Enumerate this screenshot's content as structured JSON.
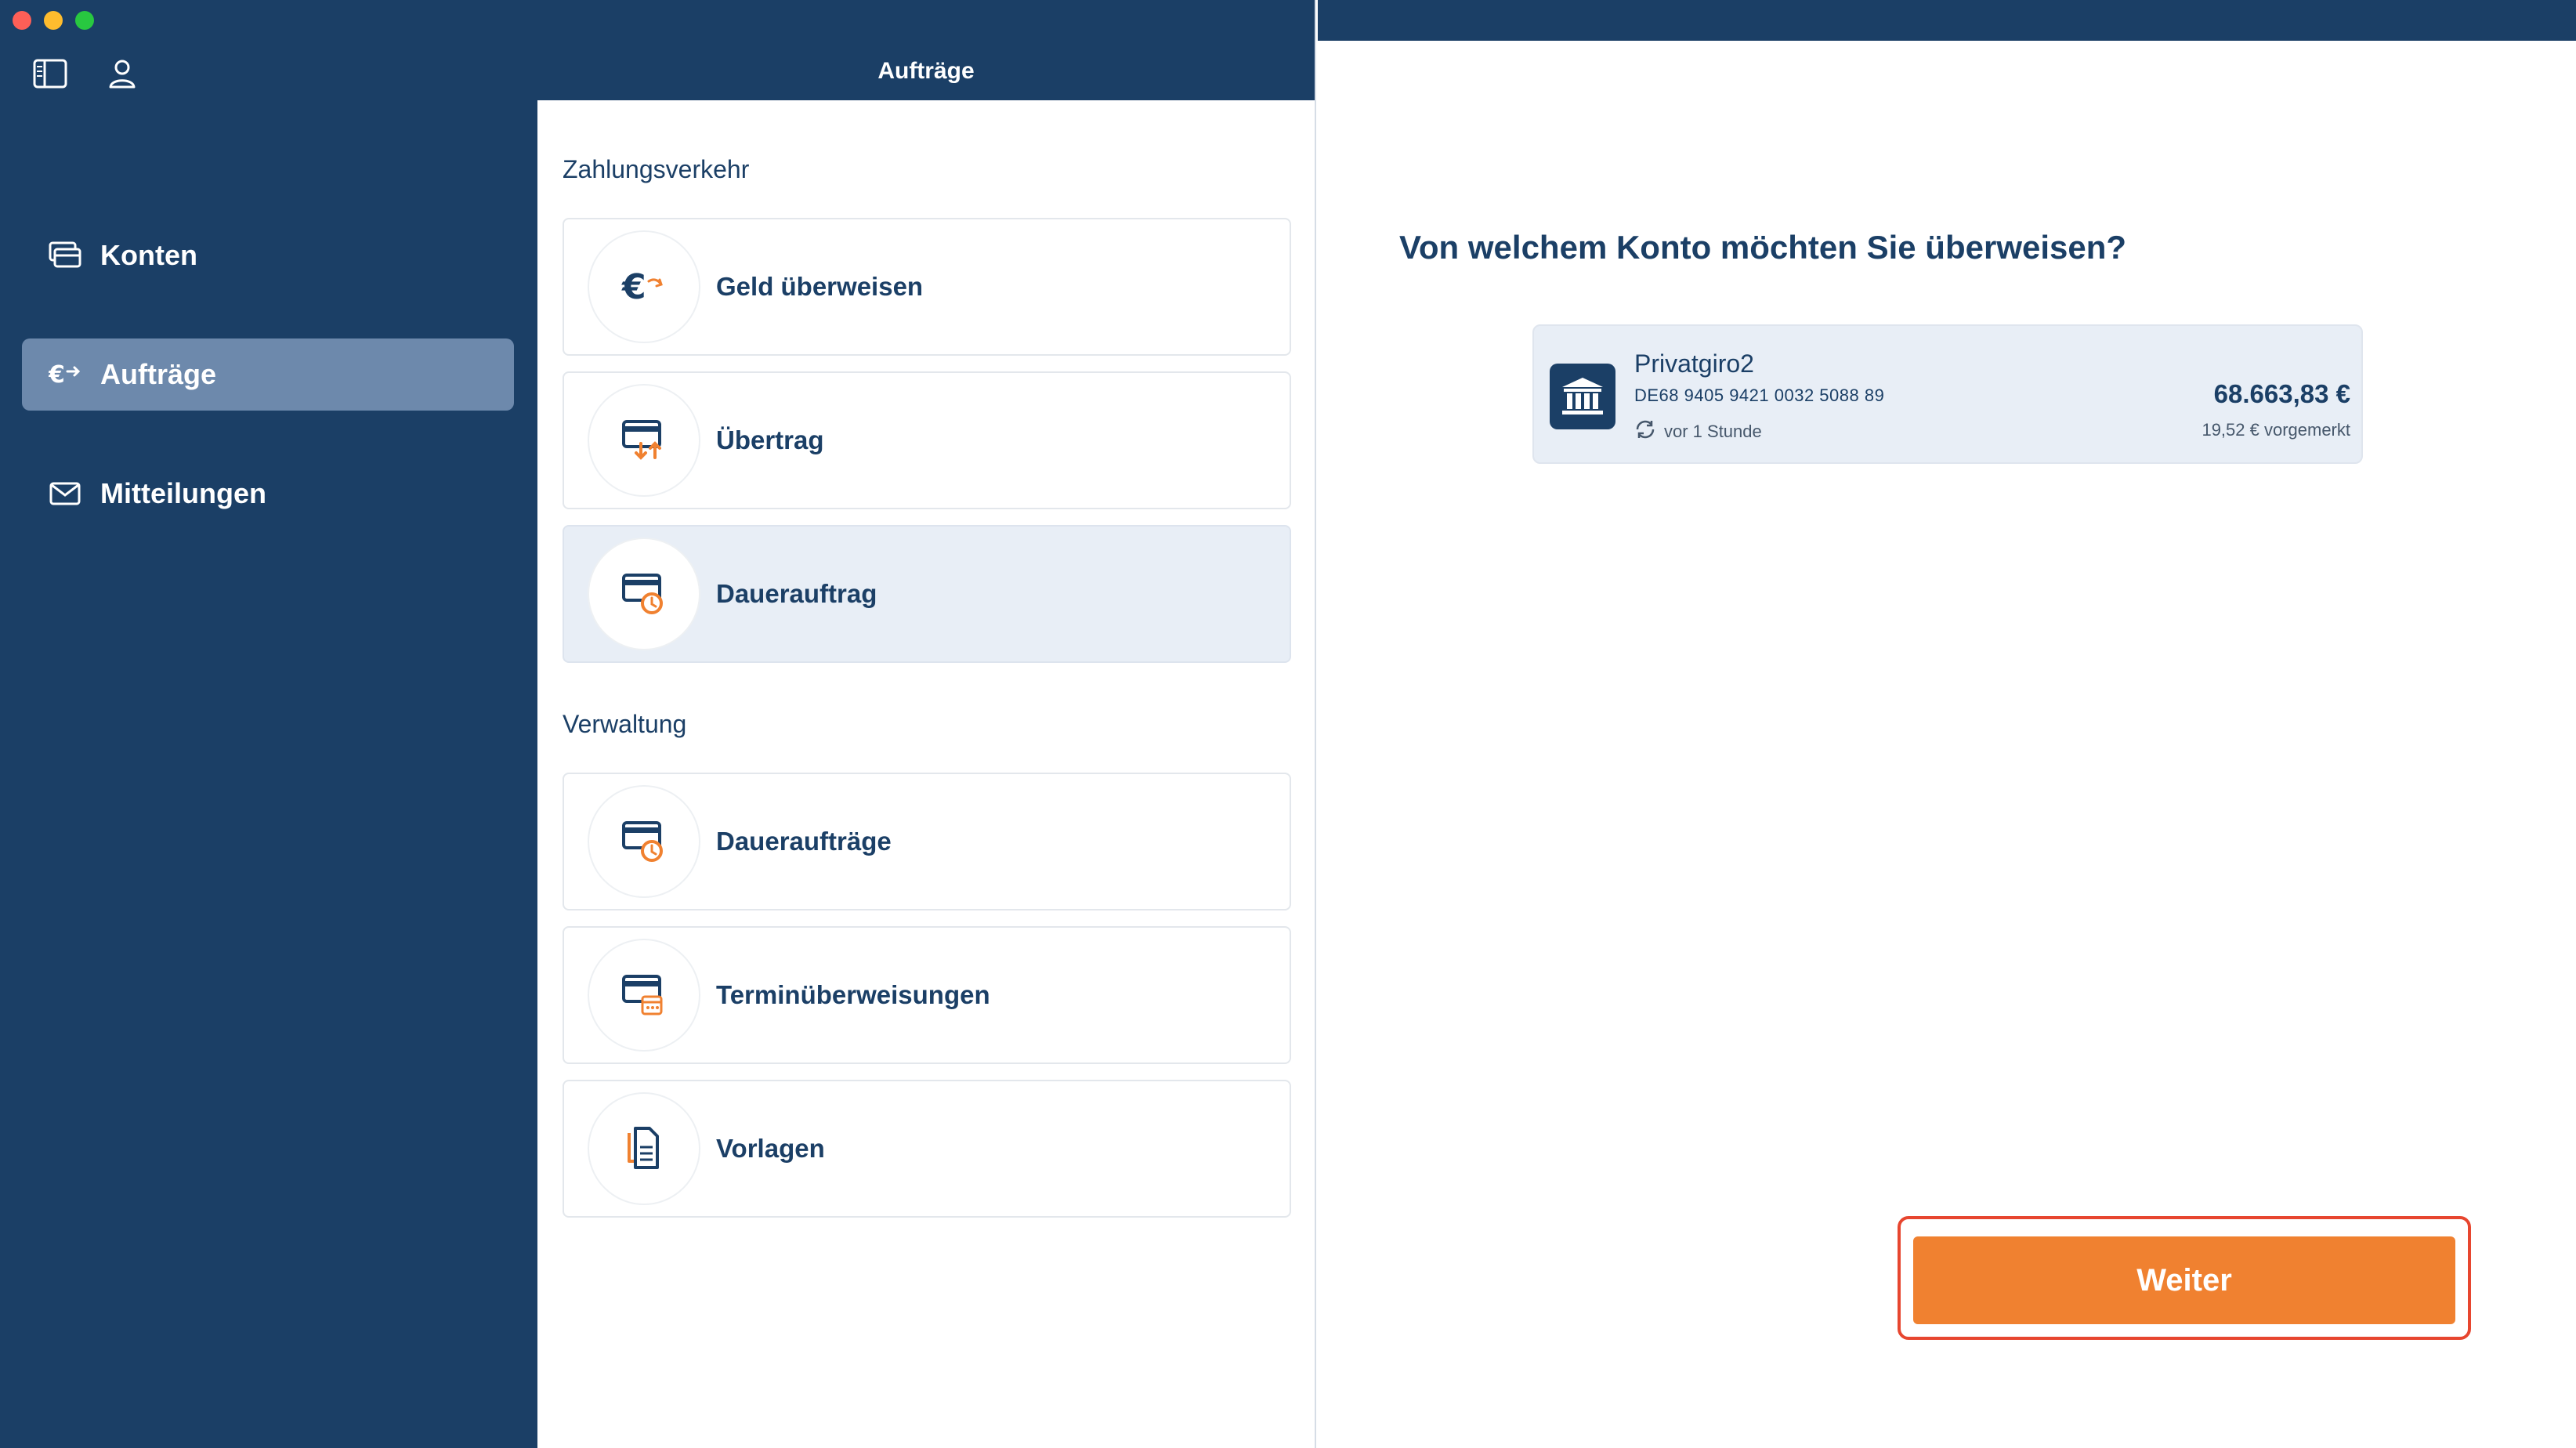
{
  "colors": {
    "navy": "#1b3f66",
    "accent_orange": "#f08130",
    "selected_nav": "#6d89ac",
    "focus_red": "#e7462f"
  },
  "sidebar": {
    "top_icons": [
      "sidebar-toggle-icon",
      "user-icon"
    ],
    "items": [
      {
        "label": "Konten",
        "icon": "accounts-icon",
        "active": false
      },
      {
        "label": "Aufträge",
        "icon": "euro-transfer-icon",
        "active": true
      },
      {
        "label": "Mitteilungen",
        "icon": "mail-icon",
        "active": false
      }
    ]
  },
  "middle": {
    "title": "Aufträge",
    "sections": [
      {
        "title": "Zahlungsverkehr",
        "items": [
          {
            "label": "Geld überweisen",
            "icon": "euro-send-icon"
          },
          {
            "label": "Übertrag",
            "icon": "card-transfer-icon"
          },
          {
            "label": "Dauerauftrag",
            "icon": "card-clock-icon",
            "selected": true
          }
        ]
      },
      {
        "title": "Verwaltung",
        "items": [
          {
            "label": "Daueraufträge",
            "icon": "card-clock-icon"
          },
          {
            "label": "Terminüberweisungen",
            "icon": "card-calendar-icon"
          },
          {
            "label": "Vorlagen",
            "icon": "document-icon"
          }
        ]
      }
    ]
  },
  "main": {
    "question": "Von welchem Konto möchten Sie überweisen?",
    "account": {
      "name": "Privatgiro2",
      "iban": "DE68 9405 9421 0032 5088 89",
      "sync": "vor 1 Stunde",
      "balance": "68.663,83 €",
      "pending": "19,52 € vorgemerkt",
      "icon": "bank-icon"
    },
    "next_button": "Weiter"
  }
}
